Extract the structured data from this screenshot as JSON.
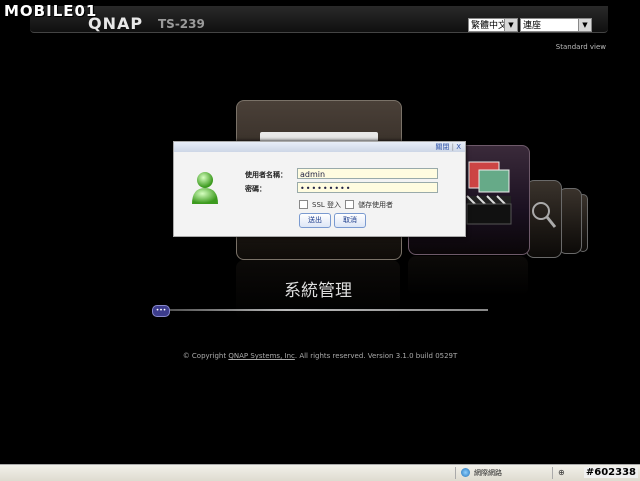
{
  "watermark": "MOBILE01",
  "header": {
    "logo": "QNAP",
    "model": "TS-239",
    "language_select": "繁體中文",
    "theme_select": "連座",
    "standard_view": "Standard view"
  },
  "main": {
    "panel_title": "系統管理",
    "copyright_prefix": "© Copyright ",
    "copyright_link": "QNAP Systems, Inc",
    "copyright_suffix": ". All rights reserved. Version 3.1.0 build 0529T"
  },
  "login": {
    "close_label": "關閉",
    "close_x": "X",
    "username_label": "使用者名稱：",
    "username_value": "admin",
    "password_label": "密碼：",
    "password_value": "•••••••••",
    "ssl_label": "SSL 登入",
    "remember_label": "儲存使用者",
    "submit_label": "送出",
    "cancel_label": "取消"
  },
  "statusbar": {
    "zone_text": "網際網路",
    "zoom_glyph": "⊕",
    "photo_id": "#602338"
  },
  "colors": {
    "background": "#000000",
    "dialog_bg": "#f3f3f3",
    "input_bg": "#fffce0",
    "link_blue": "#2a4fa8"
  }
}
